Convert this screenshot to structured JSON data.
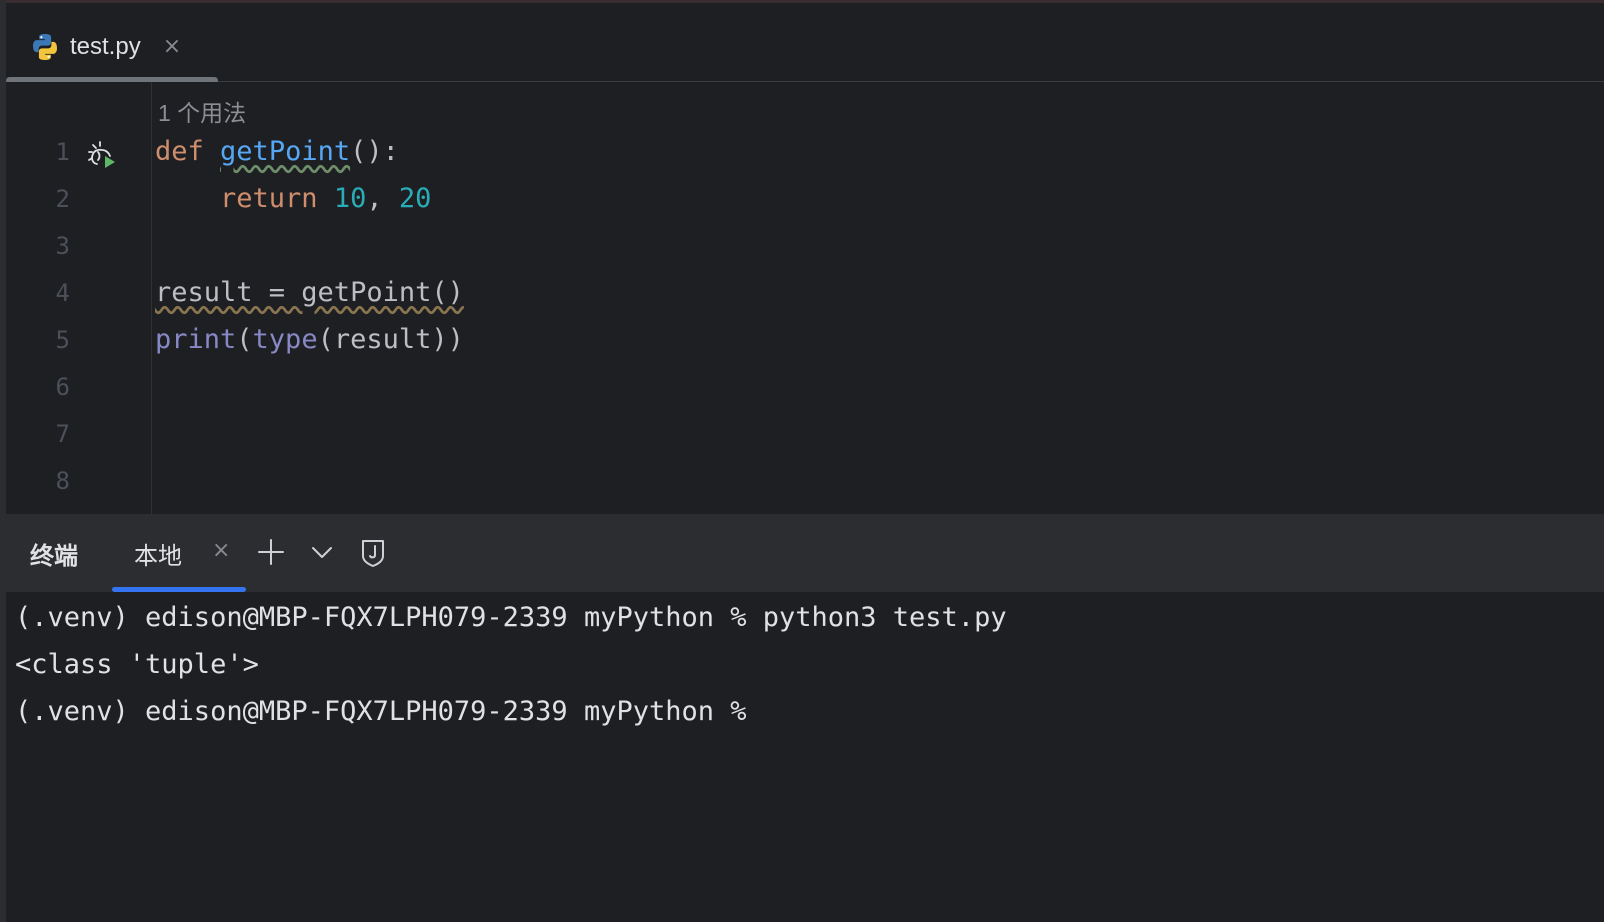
{
  "colors": {
    "background": "#1e1f22",
    "panel": "#2b2d30",
    "keyword": "#cf8e6d",
    "function_def": "#56a8f5",
    "number": "#2aacb8",
    "builtin": "#8888c6",
    "text": "#bcbec4",
    "accent": "#3574f0"
  },
  "tab": {
    "icon": "python-icon",
    "title": "test.py",
    "close": "×"
  },
  "editor": {
    "usage_hint": "1 个用法",
    "line_numbers": [
      "1",
      "2",
      "3",
      "4",
      "5",
      "6",
      "7",
      "8"
    ],
    "line1": {
      "kw": "def",
      "space": " ",
      "name": "getPoint",
      "rest": "():"
    },
    "line2": {
      "indent": "    ",
      "kw": "return",
      "sp": " ",
      "n1": "10",
      "comma": ", ",
      "n2": "20"
    },
    "line4": {
      "a": "result = getPoint()"
    },
    "line5": {
      "print": "print",
      "p1": "(",
      "type": "type",
      "rest": "(result))"
    },
    "run_icon": "run-debug-icon"
  },
  "terminal": {
    "title": "终端",
    "tab_label": "本地",
    "tab_close": "×",
    "new_tab_icon": "plus-icon",
    "dropdown_icon": "chevron-down-icon",
    "shield_icon": "shield-j-icon",
    "lines": [
      "(.venv) edison@MBP-FQX7LPH079-2339 myPython % python3 test.py",
      "<class 'tuple'>",
      "(.venv) edison@MBP-FQX7LPH079-2339 myPython %"
    ]
  }
}
